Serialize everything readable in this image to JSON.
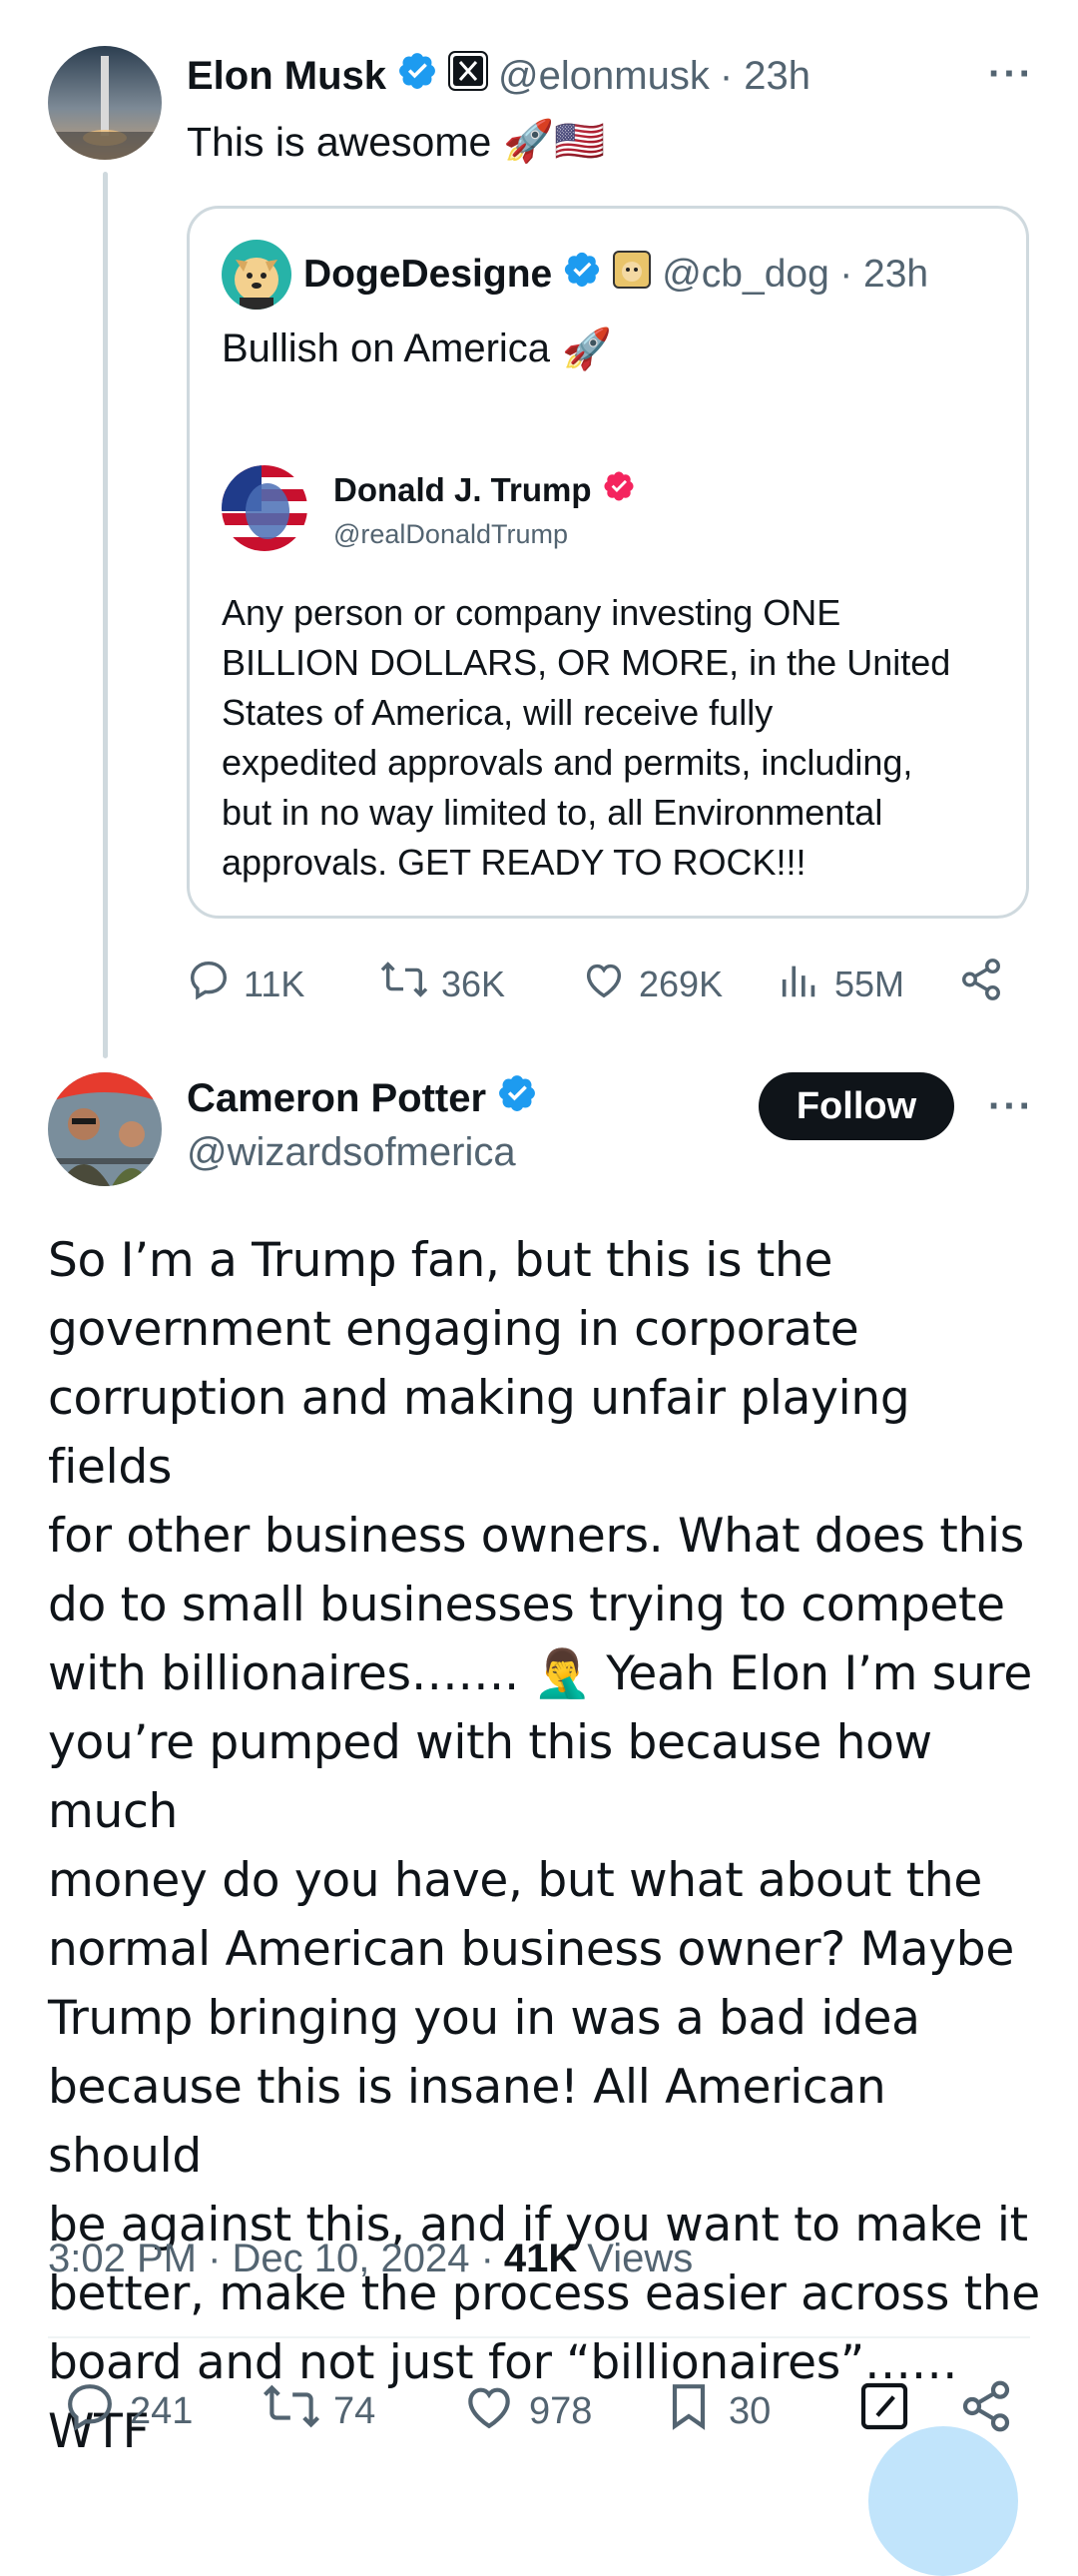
{
  "top_tweet": {
    "author_name": "Elon Musk",
    "handle": "@elonmusk",
    "time": "· 23h",
    "text": "This is awesome",
    "text_emojis": "🚀🇺🇸",
    "actions": {
      "reply": "11K",
      "retweet": "36K",
      "like": "269K",
      "views": "55M"
    }
  },
  "quote": {
    "author_name": "DogeDesigne",
    "handle": "@cb_doge",
    "time": "· 23h",
    "text": "Bullish on America",
    "text_emoji": "🚀",
    "embedded": {
      "author_name": "Donald J. Trump",
      "handle": "@realDonaldTrump",
      "text": "Any person or company investing ONE\nBILLION DOLLARS, OR MORE, in the United\nStates of America, will receive fully\nexpedited approvals and permits, including,\nbut in no way limited to, all Environmental\napprovals. GET READY TO ROCK!!!"
    }
  },
  "reply_tweet": {
    "author_name": "Cameron Potter",
    "handle": "@wizardsofmerica",
    "follow_label": "Follow",
    "text": "So I’m a Trump fan, but this is the\ngovernment engaging in corporate\ncorruption and making unfair playing fields\nfor other business owners.  What does this\ndo to small businesses trying to compete\nwith billionaires……. 🤦‍♂️ Yeah Elon I’m sure\nyou’re pumped with this because how much\nmoney do you have, but what about the\nnormal American business owner?  Maybe\nTrump bringing you in was a bad idea\nbecause this is insane!  All American should\nbe against this, and if you want to make it\nbetter, make the process easier across the\nboard and not just for “billionaires”……WTF",
    "timestamp": "3:02 PM · Dec 10, 2024 ·",
    "views_count": "41K",
    "views_label": "Views",
    "actions": {
      "reply": "241",
      "retweet": "74",
      "like": "978",
      "bookmark": "30"
    }
  },
  "colors": {
    "verified_blue": "#1d9bf0",
    "trump_badge": "#f4245e",
    "muted": "#536471",
    "border": "#cfd9de"
  },
  "icons": [
    "verified-badge-icon",
    "x-logo-icon",
    "more-icon",
    "reply-icon",
    "retweet-icon",
    "like-icon",
    "views-icon",
    "share-icon",
    "bookmark-icon",
    "compose-icon"
  ]
}
